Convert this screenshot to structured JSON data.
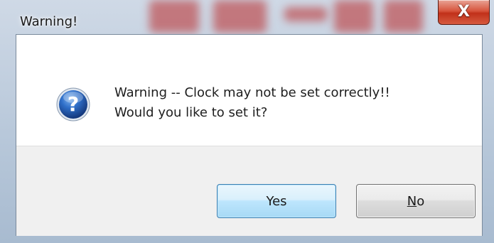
{
  "window": {
    "title": "Warning!",
    "close_label": "X"
  },
  "dialog": {
    "icon": "question-icon",
    "message_line1": "Warning -- Clock may not be set correctly!!",
    "message_line2": "Would you like to set it?"
  },
  "buttons": {
    "yes_label": "Yes",
    "no_label_mnemonic": "N",
    "no_label_rest": "o"
  },
  "colors": {
    "close_button": "#c1311a",
    "icon_blue": "#1f4f9c",
    "default_button_border": "#3c7fb1",
    "button_bar": "#f0f0f0"
  }
}
